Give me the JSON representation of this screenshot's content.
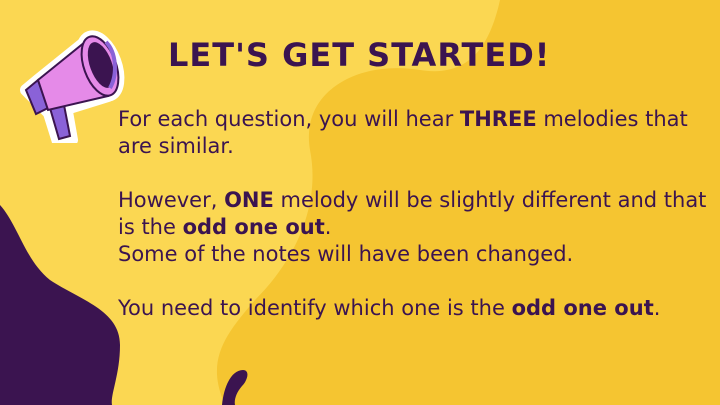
{
  "title": "LET'S GET STARTED!",
  "paragraph1": {
    "pre": "For each question, you will hear ",
    "bold": "THREE",
    "post": " melodies that are similar."
  },
  "paragraph2": {
    "pre": "However, ",
    "bold1": "ONE",
    "mid": " melody will be slightly different and that is the ",
    "bold2": "odd one out",
    "post": "."
  },
  "paragraph3": "Some of the notes will have been changed.",
  "paragraph4": {
    "pre": "You need to identify which one is the ",
    "bold": "odd one out",
    "post": "."
  },
  "icons": {
    "megaphone": "megaphone-icon"
  },
  "colors": {
    "background": "#fbd752",
    "blob": "#f5c531",
    "dark_purple": "#3b1450",
    "pink": "#e58ae8",
    "violet": "#8a62d8"
  }
}
